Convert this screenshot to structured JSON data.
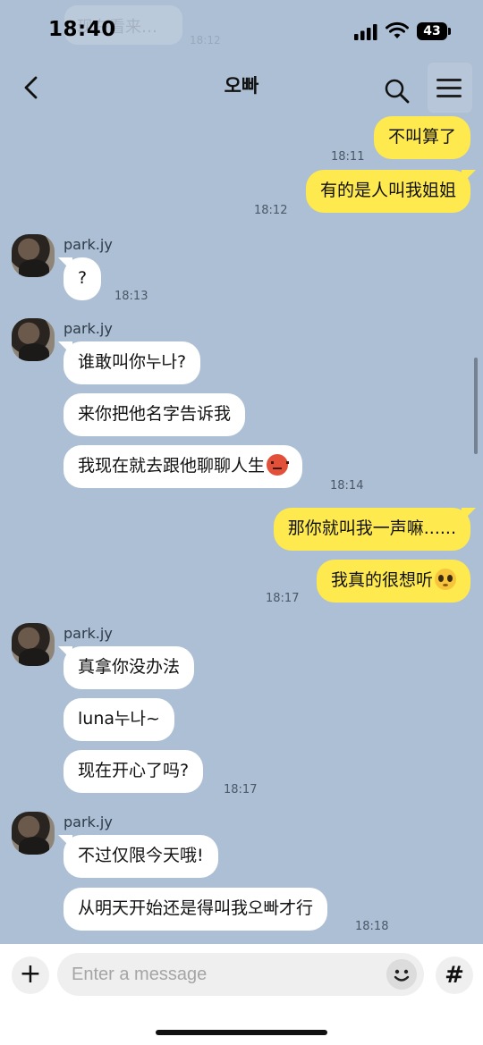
{
  "status_bar": {
    "time": "18:40",
    "battery": "43"
  },
  "background_notification": {
    "text": "现在看来…",
    "time": "18:12"
  },
  "header": {
    "title": "오빠"
  },
  "messages": [
    {
      "kind": "out",
      "text": "不叫算了"
    },
    {
      "kind": "out",
      "text": "有的是人叫我姐姐",
      "time": "18:11"
    },
    {
      "kind": "time",
      "text": "18:12"
    },
    {
      "kind": "in",
      "sender": "park.jy",
      "text": "?",
      "time": "18:13"
    },
    {
      "kind": "in",
      "sender": "park.jy",
      "text": "谁敢叫你누나?"
    },
    {
      "kind": "in",
      "text": "来你把他名字告诉我"
    },
    {
      "kind": "in",
      "text": "我现在就去跟他聊聊人生",
      "emoji": "angry-face-emoji",
      "time": "18:14"
    },
    {
      "kind": "out",
      "text": "那你就叫我一声嘛......"
    },
    {
      "kind": "out",
      "text": "我真的很想听",
      "emoji": "pleading-face-emoji",
      "time": "18:17"
    },
    {
      "kind": "in",
      "sender": "park.jy",
      "text": "真拿你没办法"
    },
    {
      "kind": "in",
      "text": "luna누나~"
    },
    {
      "kind": "in",
      "text": "现在开心了吗?",
      "time": "18:17"
    },
    {
      "kind": "in",
      "sender": "park.jy",
      "text": "不过仅限今天哦!"
    },
    {
      "kind": "in",
      "text": "从明天开始还是得叫我오빠才行",
      "time": "18:18"
    }
  ],
  "composer": {
    "placeholder": "Enter a message",
    "plus_icon": "plus-icon",
    "emoji_icon": "smiley-icon",
    "hash_icon": "hashtag-icon"
  },
  "colors": {
    "background": "#adbfd4",
    "outgoing_bubble": "#fee94e",
    "incoming_bubble": "#ffffff"
  }
}
